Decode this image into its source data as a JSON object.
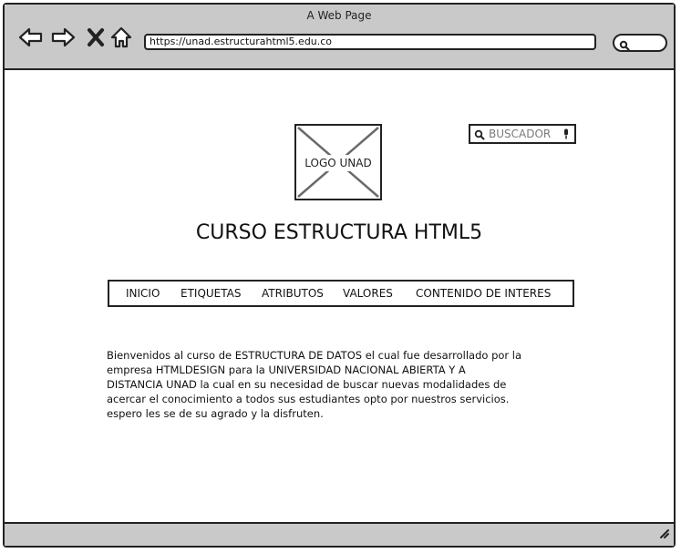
{
  "window": {
    "title": "A Web Page",
    "url": "https://unad.estructurahtml5.edu.co"
  },
  "icons": {
    "back": "arrow-left-icon",
    "forward": "arrow-right-icon",
    "close": "close-icon",
    "home": "home-icon",
    "search": "search-icon",
    "mic": "microphone-icon"
  },
  "logo": {
    "label": "LOGO UNAD"
  },
  "search": {
    "placeholder": "BUSCADOR"
  },
  "page": {
    "title": "CURSO ESTRUCTURA HTML5"
  },
  "nav": {
    "items": [
      "INICIO",
      "ETIQUETAS",
      "ATRIBUTOS",
      "VALORES",
      "CONTENIDO DE INTERES"
    ]
  },
  "intro": {
    "lines": [
      "Bienvenidos al curso de ESTRUCTURA DE DATOS  el cual fue desarrollado  por la",
      "empresa  HTMLDESIGN  para la UNIVERSIDAD NACIONAL ABIERTA Y A",
      "DISTANCIA UNAD   la  cual   en su  necesidad de buscar nuevas modalidades de",
      "acercar el conocimiento a todos sus estudiantes opto por nuestros servicios.",
      "espero les se  de su agrado  y la   disfruten."
    ]
  }
}
